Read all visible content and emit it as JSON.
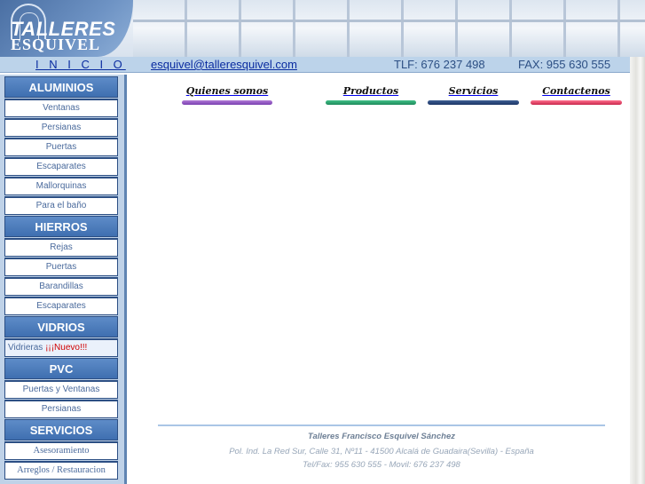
{
  "brand": {
    "line1": "TALLERES",
    "line2": "ESQUIVEL"
  },
  "topbar": {
    "inicio": "I N I C I O",
    "email": "esquivel@talleresquivel.com",
    "tlf": "TLF: 676 237 498",
    "fax": "FAX: 955 630 555"
  },
  "sidebar": {
    "aluminios": {
      "title": "ALUMINIOS",
      "items": [
        "Ventanas",
        "Persianas",
        "Puertas",
        "Escaparates",
        "Mallorquinas",
        "Para el baño"
      ]
    },
    "hierros": {
      "title": "HIERROS",
      "items": [
        "Rejas",
        "Puertas",
        "Barandillas",
        "Escaparates"
      ]
    },
    "vidrios": {
      "title": "VIDRIOS",
      "item_label": "Vidrieras",
      "item_new": "¡¡¡Nuevo!!!"
    },
    "pvc": {
      "title": "PVC",
      "items": [
        "Puertas y Ventanas",
        "Persianas"
      ]
    },
    "servicios": {
      "title": "SERVICIOS",
      "items": [
        "Asesoramiento",
        "Arreglos / Restauracion"
      ]
    }
  },
  "nav": {
    "quienes": "Quienes somos",
    "productos": "Productos",
    "servicios": "Servicios",
    "contactenos": "Contactenos"
  },
  "footer": {
    "company": "Talleres Francisco Esquivel Sánchez",
    "address": "Pol. Ind. La Red Sur, Calle 31, Nº11  -  41500 Alcalá de Guadaira(Sevilla) - España",
    "phones": "Tel/Fax: 955 630 555 - Movil: 676 237 498"
  },
  "colors": {
    "sidebar_bg": "#bfd2e8",
    "heading_bg": "#4b7bbd",
    "link": "#0a2ca0"
  }
}
